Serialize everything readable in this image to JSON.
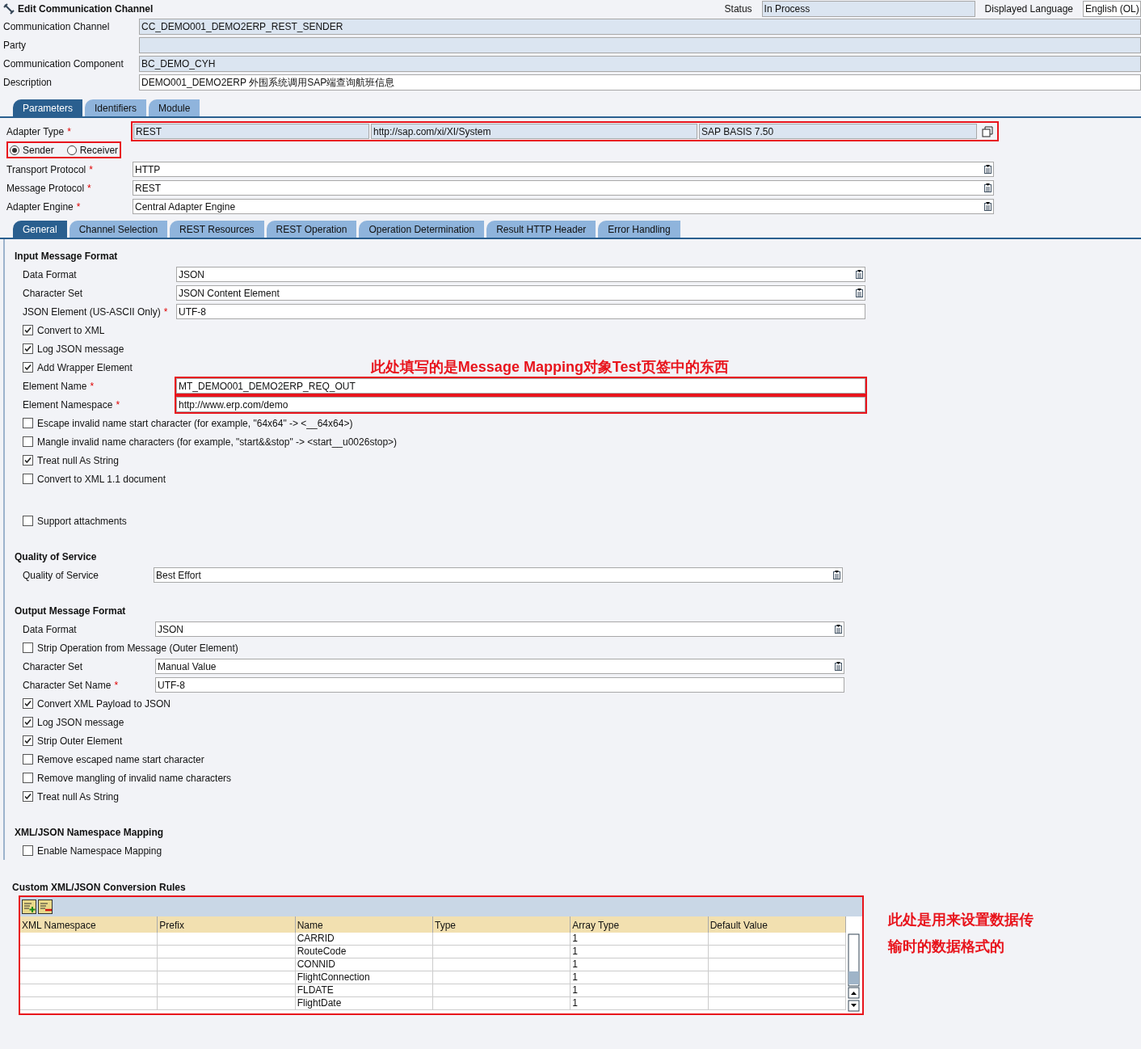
{
  "header": {
    "title": "Edit Communication Channel",
    "status_label": "Status",
    "status": "In Process",
    "language_label": "Displayed Language",
    "language": "English (OL)"
  },
  "header_fields": [
    {
      "label": "Communication Channel",
      "value": "CC_DEMO001_DEMO2ERP_REST_SENDER",
      "readonly": true
    },
    {
      "label": "Party",
      "readonly": true
    },
    {
      "label": "Communication Component",
      "value": "BC_DEMO_CYH",
      "readonly": true
    },
    {
      "label": "Description",
      "value": "DEMO001_DEMO2ERP 外围系统调用SAP端查询航班信息",
      "readonly": false
    }
  ],
  "main_tabs": [
    {
      "label": "Parameters",
      "selected": true
    },
    {
      "label": "Identifiers",
      "selected": false
    },
    {
      "label": "Module",
      "selected": false
    }
  ],
  "adapter": {
    "label": "Adapter Type",
    "required_mark": "*",
    "type": "REST",
    "namespace": "http://sap.com/xi/XI/System",
    "version": "SAP BASIS 7.50"
  },
  "direction": [
    {
      "label": "Sender",
      "selected": true
    },
    {
      "label": "Receiver",
      "selected": false
    }
  ],
  "protocol_fields": [
    {
      "label": "Transport Protocol",
      "required_mark": "*",
      "value": "HTTP"
    },
    {
      "label": "Message Protocol",
      "required_mark": "*",
      "value": "REST"
    },
    {
      "label": "Adapter Engine",
      "required_mark": "*",
      "value": "Central Adapter Engine"
    }
  ],
  "sub_tabs": [
    {
      "label": "General",
      "selected": true
    },
    {
      "label": "Channel Selection",
      "selected": false
    },
    {
      "label": "REST Resources",
      "selected": false
    },
    {
      "label": "REST Operation",
      "selected": false
    },
    {
      "label": "Operation Determination",
      "selected": false
    },
    {
      "label": "Result HTTP Header",
      "selected": false
    },
    {
      "label": "Error Handling",
      "selected": false
    }
  ],
  "sections": [
    {
      "title": "Input Message Format",
      "items": [
        {
          "kind": "field",
          "label": "Data Format",
          "value": "JSON",
          "dropdown": true
        },
        {
          "kind": "field",
          "label": "Character Set",
          "value": "JSON Content Element",
          "dropdown": true
        },
        {
          "kind": "field",
          "label": "JSON Element (US-ASCII Only)",
          "required_mark": "*",
          "value": "UTF-8",
          "dropdown": false
        },
        {
          "kind": "checkbox",
          "label": "Convert to XML",
          "checked": true
        },
        {
          "kind": "checkbox",
          "label": "Log JSON message",
          "checked": true
        },
        {
          "kind": "checkbox",
          "label": "Add Wrapper Element",
          "checked": true,
          "note": "此处填写的是Message Mapping对象Test页签中的东西"
        },
        {
          "kind": "field",
          "label": "Element Name",
          "required_mark": "*",
          "value": "MT_DEMO001_DEMO2ERP_REQ_OUT",
          "dropdown": false,
          "highlighted": true
        },
        {
          "kind": "field",
          "label": "Element Namespace",
          "required_mark": "*",
          "value": "http://www.erp.com/demo",
          "dropdown": false,
          "highlighted": true
        },
        {
          "kind": "checkbox",
          "label": "Escape invalid name start character (for example, \"64x64\" -> <__64x64>)",
          "checked": false
        },
        {
          "kind": "checkbox",
          "label": "Mangle invalid name characters (for example, \"start&&stop\" -> <start__u0026stop>)",
          "checked": false
        },
        {
          "kind": "checkbox",
          "label": "Treat null As String",
          "checked": true
        },
        {
          "kind": "checkbox",
          "label": "Convert to XML 1.1 document",
          "checked": false
        },
        {
          "kind": "spacer"
        },
        {
          "kind": "checkbox",
          "label": "Support attachments",
          "checked": false
        }
      ]
    },
    {
      "title": "Quality of Service",
      "items": [
        {
          "kind": "field",
          "label": "Quality of Service",
          "value": "Best Effort",
          "dropdown": true
        }
      ]
    },
    {
      "title": "Output Message Format",
      "items": [
        {
          "kind": "field",
          "label": "Data Format",
          "value": "JSON",
          "dropdown": true
        },
        {
          "kind": "checkbox",
          "label": "Strip Operation from Message (Outer Element)",
          "checked": false
        },
        {
          "kind": "field",
          "label": "Character Set",
          "value": "Manual Value",
          "dropdown": true
        },
        {
          "kind": "field",
          "label": "Character Set Name",
          "required_mark": "*",
          "value": "UTF-8",
          "dropdown": false
        },
        {
          "kind": "checkbox",
          "label": "Convert XML Payload to JSON",
          "checked": true
        },
        {
          "kind": "checkbox",
          "label": "Log JSON message",
          "checked": true
        },
        {
          "kind": "checkbox",
          "label": "Strip Outer Element",
          "checked": true
        },
        {
          "kind": "checkbox",
          "label": "Remove escaped name start character",
          "checked": false
        },
        {
          "kind": "checkbox",
          "label": "Remove mangling of invalid name characters",
          "checked": false
        },
        {
          "kind": "checkbox",
          "label": "Treat null As String",
          "checked": true
        }
      ]
    },
    {
      "title": "XML/JSON Namespace Mapping",
      "items": [
        {
          "kind": "checkbox",
          "label": "Enable Namespace Mapping",
          "checked": false
        }
      ]
    }
  ],
  "rules": {
    "title": "Custom XML/JSON Conversion Rules",
    "columns": [
      "XML Namespace",
      "Prefix",
      "Name",
      "Type",
      "Array Type",
      "Default Value"
    ],
    "rows": [
      [
        "",
        "",
        "CARRID",
        "",
        "1",
        ""
      ],
      [
        "",
        "",
        "RouteCode",
        "",
        "1",
        ""
      ],
      [
        "",
        "",
        "CONNID",
        "",
        "1",
        ""
      ],
      [
        "",
        "",
        "FlightConnection",
        "",
        "1",
        ""
      ],
      [
        "",
        "",
        "FLDATE",
        "",
        "1",
        ""
      ],
      [
        "",
        "",
        "FlightDate",
        "",
        "1",
        ""
      ]
    ],
    "note": "此处是用来设置数据传输时的数据格式的"
  }
}
